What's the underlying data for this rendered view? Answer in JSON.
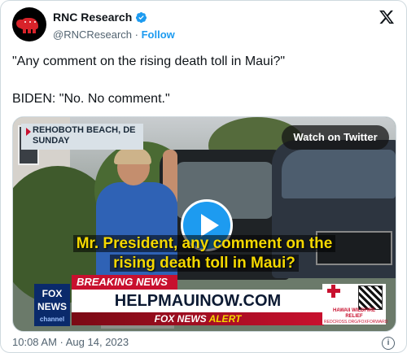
{
  "account": {
    "name": "RNC Research",
    "handle": "@RNCResearch",
    "separator": "·",
    "follow_label": "Follow"
  },
  "tweet": {
    "line1": "\"Any comment on the rising death toll in Maui?\"",
    "line2": "BIDEN: \"No. No comment.\""
  },
  "video": {
    "location_line1": "REHOBOTH BEACH, DE",
    "location_line2": "SUNDAY",
    "watch_label": "Watch on Twitter",
    "caption_line1": "Mr. President, any comment on the",
    "caption_line2": "rising death toll in Maui?",
    "breaking_label": "BREAKING NEWS",
    "lower_third": "HELPMAUINOW.COM",
    "alert_brand": "FOX NEWS",
    "alert_word": "ALERT",
    "network_logo_line1": "FOX",
    "network_logo_line2": "NEWS",
    "network_logo_line3": "channel",
    "relief_title": "HAWAII WILDFIRE RELIEF",
    "relief_url": "REDCROSS.ORG/FOXFORWARD"
  },
  "footer": {
    "timestamp": "10:08 AM · Aug 14, 2023"
  },
  "colors": {
    "accent": "#1d9bf0",
    "breaking": "#c8102e",
    "caption": "#f5d800"
  },
  "icons": [
    "gop-elephant-avatar",
    "verified-badge-icon",
    "x-logo-icon",
    "play-icon",
    "info-icon"
  ]
}
